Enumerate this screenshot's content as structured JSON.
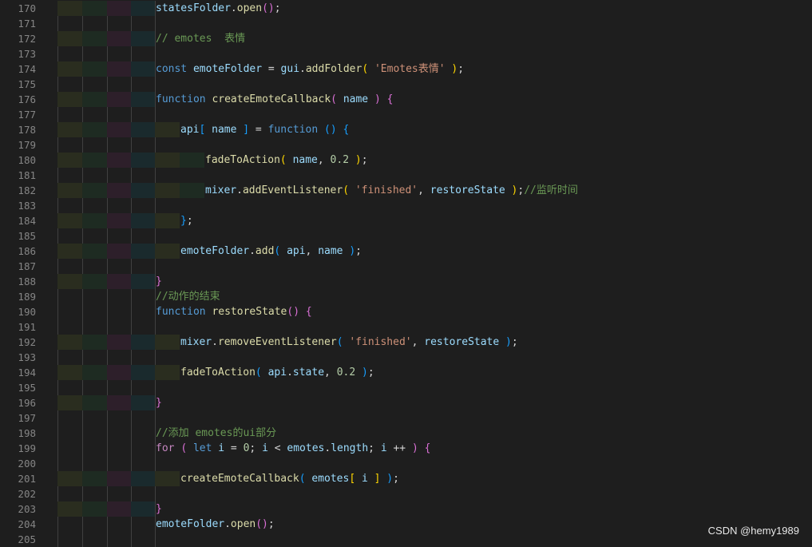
{
  "watermark": "CSDN @hemy1989",
  "colors": {
    "background": "#1e1e1e",
    "line_number": "#858585",
    "keyword": "#569cd6",
    "function": "#dcdcaa",
    "variable": "#9cdcfe",
    "string": "#ce9178",
    "number": "#b5cea8",
    "comment": "#6a9955",
    "bracket_gold": "#ffd700",
    "bracket_purple": "#da70d6",
    "bracket_blue": "#179fff",
    "control": "#c586c0"
  },
  "lines": [
    {
      "n": "170",
      "indent": 0,
      "tokens": [
        [
          "var",
          "statesFolder"
        ],
        [
          "pl",
          "."
        ],
        [
          "fn",
          "open"
        ],
        [
          "b2",
          "()"
        ],
        [
          "pl",
          ";"
        ]
      ]
    },
    {
      "n": "171",
      "indent": 0,
      "tokens": []
    },
    {
      "n": "172",
      "indent": 0,
      "tokens": [
        [
          "cm",
          "// emotes  表情"
        ]
      ]
    },
    {
      "n": "173",
      "indent": 0,
      "tokens": []
    },
    {
      "n": "174",
      "indent": 0,
      "tokens": [
        [
          "kw",
          "const "
        ],
        [
          "var",
          "emoteFolder"
        ],
        [
          "pl",
          " = "
        ],
        [
          "var",
          "gui"
        ],
        [
          "pl",
          "."
        ],
        [
          "fn",
          "addFolder"
        ],
        [
          "b1",
          "( "
        ],
        [
          "str",
          "'Emotes表情'"
        ],
        [
          "b1",
          " )"
        ],
        [
          "pl",
          ";"
        ]
      ]
    },
    {
      "n": "175",
      "indent": 0,
      "tokens": []
    },
    {
      "n": "176",
      "indent": 0,
      "tokens": [
        [
          "kw",
          "function "
        ],
        [
          "fn",
          "createEmoteCallback"
        ],
        [
          "b2",
          "( "
        ],
        [
          "var",
          "name"
        ],
        [
          "b2",
          " ) "
        ],
        [
          "b2",
          "{"
        ]
      ]
    },
    {
      "n": "177",
      "indent": 0,
      "tokens": []
    },
    {
      "n": "178",
      "indent": 1,
      "tokens": [
        [
          "var",
          "api"
        ],
        [
          "b3",
          "[ "
        ],
        [
          "var",
          "name"
        ],
        [
          "b3",
          " ]"
        ],
        [
          "pl",
          " = "
        ],
        [
          "kw",
          "function "
        ],
        [
          "b3",
          "() {"
        ]
      ]
    },
    {
      "n": "179",
      "indent": 0,
      "tokens": []
    },
    {
      "n": "180",
      "indent": 2,
      "tokens": [
        [
          "fn",
          "fadeToAction"
        ],
        [
          "b1",
          "( "
        ],
        [
          "var",
          "name"
        ],
        [
          "pl",
          ", "
        ],
        [
          "num",
          "0.2"
        ],
        [
          "b1",
          " )"
        ],
        [
          "pl",
          ";"
        ]
      ]
    },
    {
      "n": "181",
      "indent": 0,
      "tokens": []
    },
    {
      "n": "182",
      "indent": 2,
      "tokens": [
        [
          "var",
          "mixer"
        ],
        [
          "pl",
          "."
        ],
        [
          "fn",
          "addEventListener"
        ],
        [
          "b1",
          "( "
        ],
        [
          "str",
          "'finished'"
        ],
        [
          "pl",
          ", "
        ],
        [
          "var",
          "restoreState"
        ],
        [
          "b1",
          " )"
        ],
        [
          "pl",
          ";"
        ],
        [
          "cm",
          "//监听时间"
        ]
      ]
    },
    {
      "n": "183",
      "indent": 0,
      "tokens": []
    },
    {
      "n": "184",
      "indent": 1,
      "tokens": [
        [
          "b3",
          "}"
        ],
        [
          "pl",
          ";"
        ]
      ]
    },
    {
      "n": "185",
      "indent": 0,
      "tokens": []
    },
    {
      "n": "186",
      "indent": 1,
      "tokens": [
        [
          "var",
          "emoteFolder"
        ],
        [
          "pl",
          "."
        ],
        [
          "fn",
          "add"
        ],
        [
          "b3",
          "( "
        ],
        [
          "var",
          "api"
        ],
        [
          "pl",
          ", "
        ],
        [
          "var",
          "name"
        ],
        [
          "b3",
          " )"
        ],
        [
          "pl",
          ";"
        ]
      ]
    },
    {
      "n": "187",
      "indent": 0,
      "tokens": []
    },
    {
      "n": "188",
      "indent": 0,
      "tokens": [
        [
          "b2",
          "}"
        ]
      ]
    },
    {
      "n": "189",
      "indent": 0,
      "tokens": [
        [
          "cm",
          "//动作的结束"
        ]
      ]
    },
    {
      "n": "190",
      "indent": 0,
      "tokens": [
        [
          "kw",
          "function "
        ],
        [
          "fn",
          "restoreState"
        ],
        [
          "b2",
          "() {"
        ]
      ]
    },
    {
      "n": "191",
      "indent": 0,
      "tokens": []
    },
    {
      "n": "192",
      "indent": 1,
      "tokens": [
        [
          "var",
          "mixer"
        ],
        [
          "pl",
          "."
        ],
        [
          "fn",
          "removeEventListener"
        ],
        [
          "b3",
          "( "
        ],
        [
          "str",
          "'finished'"
        ],
        [
          "pl",
          ", "
        ],
        [
          "var",
          "restoreState"
        ],
        [
          "b3",
          " )"
        ],
        [
          "pl",
          ";"
        ]
      ]
    },
    {
      "n": "193",
      "indent": 0,
      "tokens": []
    },
    {
      "n": "194",
      "indent": 1,
      "tokens": [
        [
          "fn",
          "fadeToAction"
        ],
        [
          "b3",
          "( "
        ],
        [
          "var",
          "api"
        ],
        [
          "pl",
          "."
        ],
        [
          "var",
          "state"
        ],
        [
          "pl",
          ", "
        ],
        [
          "num",
          "0.2"
        ],
        [
          "b3",
          " )"
        ],
        [
          "pl",
          ";"
        ]
      ]
    },
    {
      "n": "195",
      "indent": 0,
      "tokens": []
    },
    {
      "n": "196",
      "indent": 0,
      "tokens": [
        [
          "b2",
          "}"
        ]
      ]
    },
    {
      "n": "197",
      "indent": 0,
      "tokens": []
    },
    {
      "n": "198",
      "indent": 0,
      "tokens": [
        [
          "cm",
          "//添加 emotes的ui部分"
        ]
      ]
    },
    {
      "n": "199",
      "indent": 0,
      "tokens": [
        [
          "ctl",
          "for "
        ],
        [
          "b2",
          "( "
        ],
        [
          "kw",
          "let "
        ],
        [
          "var",
          "i"
        ],
        [
          "pl",
          " = "
        ],
        [
          "num",
          "0"
        ],
        [
          "pl",
          "; "
        ],
        [
          "var",
          "i"
        ],
        [
          "pl",
          " < "
        ],
        [
          "var",
          "emotes"
        ],
        [
          "pl",
          "."
        ],
        [
          "var",
          "length"
        ],
        [
          "pl",
          "; "
        ],
        [
          "var",
          "i"
        ],
        [
          "pl",
          " ++ "
        ],
        [
          "b2",
          ") {"
        ]
      ]
    },
    {
      "n": "200",
      "indent": 0,
      "tokens": []
    },
    {
      "n": "201",
      "indent": 1,
      "tokens": [
        [
          "fn",
          "createEmoteCallback"
        ],
        [
          "b3",
          "( "
        ],
        [
          "var",
          "emotes"
        ],
        [
          "b1",
          "[ "
        ],
        [
          "var",
          "i"
        ],
        [
          "b1",
          " ]"
        ],
        [
          "b3",
          " )"
        ],
        [
          "pl",
          ";"
        ]
      ]
    },
    {
      "n": "202",
      "indent": 0,
      "tokens": []
    },
    {
      "n": "203",
      "indent": 0,
      "tokens": [
        [
          "b2",
          "}"
        ]
      ]
    },
    {
      "n": "204",
      "indent": 0,
      "tokens": [
        [
          "var",
          "emoteFolder"
        ],
        [
          "pl",
          "."
        ],
        [
          "fn",
          "open"
        ],
        [
          "b2",
          "()"
        ],
        [
          "pl",
          ";"
        ]
      ]
    },
    {
      "n": "205",
      "indent": 0,
      "tokens": []
    }
  ]
}
